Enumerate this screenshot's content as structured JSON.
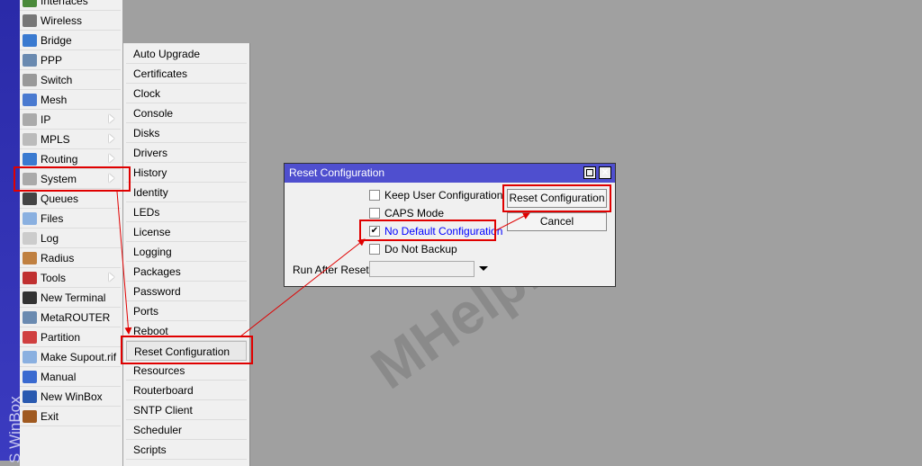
{
  "brand": "S WinBox",
  "menu": {
    "items": [
      {
        "label": "Interfaces",
        "icon": "interfaces-icon",
        "color": "#4a8a3a"
      },
      {
        "label": "Wireless",
        "icon": "wireless-icon",
        "color": "#777"
      },
      {
        "label": "Bridge",
        "icon": "bridge-icon",
        "color": "#3a7ad0"
      },
      {
        "label": "PPP",
        "icon": "ppp-icon",
        "color": "#6a8ab0"
      },
      {
        "label": "Switch",
        "icon": "switch-icon",
        "color": "#999"
      },
      {
        "label": "Mesh",
        "icon": "mesh-icon",
        "color": "#4a7ad0"
      },
      {
        "label": "IP",
        "icon": "ip-icon",
        "color": "#aaa",
        "sub": true
      },
      {
        "label": "MPLS",
        "icon": "mpls-icon",
        "color": "#bbb",
        "sub": true
      },
      {
        "label": "Routing",
        "icon": "routing-icon",
        "color": "#3a7ad0",
        "sub": true
      },
      {
        "label": "System",
        "icon": "gear-icon",
        "color": "#aaa",
        "sub": true
      },
      {
        "label": "Queues",
        "icon": "queues-icon",
        "color": "#444"
      },
      {
        "label": "Files",
        "icon": "folder-icon",
        "color": "#8ab0e0"
      },
      {
        "label": "Log",
        "icon": "log-icon",
        "color": "#ccc"
      },
      {
        "label": "Radius",
        "icon": "radius-icon",
        "color": "#c08040"
      },
      {
        "label": "Tools",
        "icon": "tools-icon",
        "color": "#c03030",
        "sub": true
      },
      {
        "label": "New Terminal",
        "icon": "terminal-icon",
        "color": "#333"
      },
      {
        "label": "MetaROUTER",
        "icon": "metarouter-icon",
        "color": "#6a8ab0"
      },
      {
        "label": "Partition",
        "icon": "partition-icon",
        "color": "#d04040"
      },
      {
        "label": "Make Supout.rif",
        "icon": "supout-icon",
        "color": "#8ab0e0"
      },
      {
        "label": "Manual",
        "icon": "help-icon",
        "color": "#3a6ad0"
      },
      {
        "label": "New WinBox",
        "icon": "winbox-icon",
        "color": "#2a5ab0"
      },
      {
        "label": "Exit",
        "icon": "exit-icon",
        "color": "#a05a20"
      }
    ]
  },
  "submenu": {
    "items": [
      "Auto Upgrade",
      "Certificates",
      "Clock",
      "Console",
      "Disks",
      "Drivers",
      "History",
      "Identity",
      "LEDs",
      "License",
      "Logging",
      "Packages",
      "Password",
      "Ports",
      "Reboot",
      "Reset Configuration",
      "Resources",
      "Routerboard",
      "SNTP Client",
      "Scheduler",
      "Scripts"
    ]
  },
  "dialog": {
    "title": "Reset Configuration",
    "options": [
      {
        "label": "Keep User Configuration",
        "checked": false
      },
      {
        "label": "CAPS Mode",
        "checked": false
      },
      {
        "label": "No Default Configuration",
        "checked": true
      },
      {
        "label": "Do Not Backup",
        "checked": false
      }
    ],
    "run_after_reset_label": "Run After Reset:",
    "run_after_reset_value": "",
    "reset_button": "Reset Configuration",
    "cancel_button": "Cancel"
  },
  "watermark": "MHelp.kz",
  "colors": {
    "highlight": "#e00000",
    "titlebar": "#4f4fcf",
    "link": "#0000ff"
  }
}
